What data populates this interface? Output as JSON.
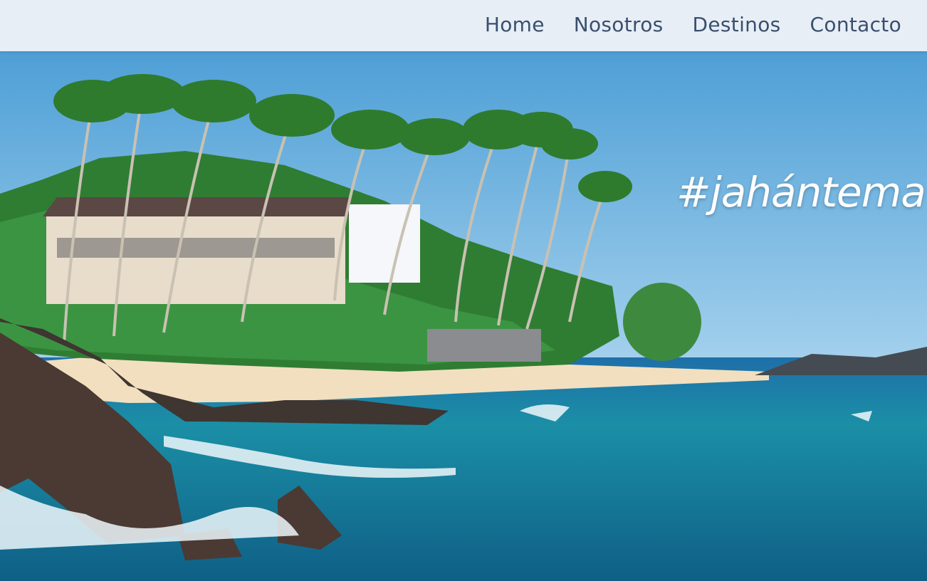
{
  "nav": {
    "items": [
      {
        "label": "Home"
      },
      {
        "label": "Nosotros"
      },
      {
        "label": "Destinos"
      },
      {
        "label": "Contacto"
      }
    ]
  },
  "hero": {
    "tagline": "#jahántema",
    "image": "tropical-beach-photo"
  },
  "colors": {
    "nav_bg": "#e8eef6",
    "nav_text": "#3a4f6e",
    "sky": "#5fa9d8",
    "sea": "#1a8aa3",
    "sand": "#f1dfc0"
  }
}
